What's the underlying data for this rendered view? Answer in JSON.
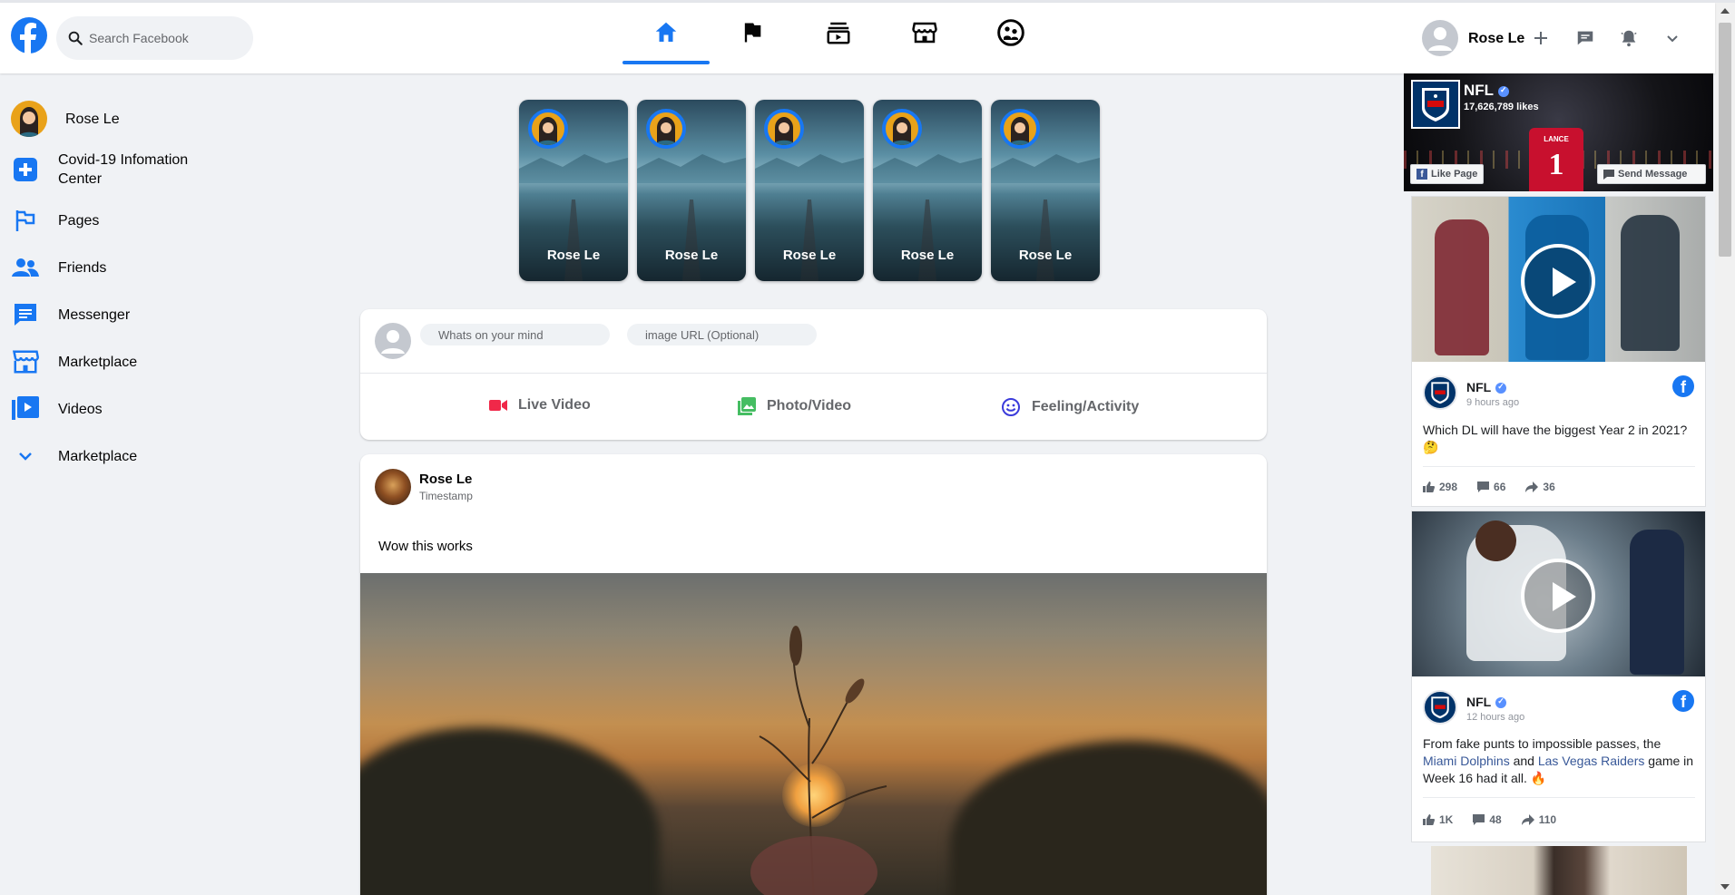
{
  "header": {
    "search_placeholder": "Search Facebook",
    "nav_tabs": [
      "home",
      "pages",
      "watch",
      "marketplace",
      "groups"
    ],
    "user_name": "Rose Le"
  },
  "sidebar": {
    "items": [
      {
        "label": "Rose Le",
        "icon": "avatar"
      },
      {
        "label": "Covid-19 Infomation Center",
        "icon": "plus-icon"
      },
      {
        "label": "Pages",
        "icon": "flag-icon"
      },
      {
        "label": "Friends",
        "icon": "people-icon"
      },
      {
        "label": "Messenger",
        "icon": "chat-icon"
      },
      {
        "label": "Marketplace",
        "icon": "store-icon"
      },
      {
        "label": "Videos",
        "icon": "play-icon"
      },
      {
        "label": "Marketplace",
        "icon": "chevron-down-icon"
      }
    ]
  },
  "stories": [
    {
      "name": "Rose Le"
    },
    {
      "name": "Rose Le"
    },
    {
      "name": "Rose Le"
    },
    {
      "name": "Rose Le"
    },
    {
      "name": "Rose Le"
    }
  ],
  "composer": {
    "status_placeholder": "Whats on your mind",
    "image_placeholder": "image URL (Optional)",
    "options": [
      "Live Video",
      "Photo/Video",
      "Feeling/Activity"
    ]
  },
  "post": {
    "author": "Rose Le",
    "timestamp": "Timestamp",
    "text": "Wow this works"
  },
  "right": {
    "page": {
      "name": "NFL",
      "likes": "17,626,789 likes",
      "like_button": "Like Page",
      "message_button": "Send Message",
      "jersey_name": "LANCE",
      "jersey_number": "1"
    },
    "posts": [
      {
        "name": "NFL",
        "time": "9 hours ago",
        "text": "Which DL will have the biggest Year 2 in 2021? 🤔",
        "likes": "298",
        "comments": "66",
        "shares": "36"
      },
      {
        "name": "NFL",
        "time": "12 hours ago",
        "text_a": "From fake punts to impossible passes, the ",
        "link1": "Miami Dolphins",
        "text_b": " and ",
        "link2": "Las Vegas Raiders",
        "text_c": " game in Week 16 had it all. 🔥",
        "likes": "1K",
        "comments": "48",
        "shares": "110"
      }
    ]
  },
  "colors": {
    "brand": "#1877f2",
    "background": "#f0f2f5",
    "live_video": "#f02849",
    "photo_video": "#45bd62",
    "feeling": "#3b3bdb"
  }
}
